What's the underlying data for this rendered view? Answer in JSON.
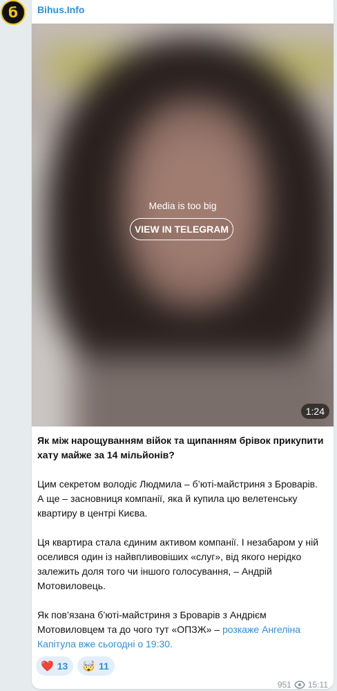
{
  "avatar": {
    "glyph": "б"
  },
  "post": {
    "channel_name": "Bihus.Info",
    "media": {
      "message": "Media is too big",
      "button_label": "VIEW IN TELEGRAM",
      "duration": "1:24"
    },
    "headline": "Як між нарощуванням війок та щипанням брівок прикупити хату майже за 14 мільйонів?",
    "paragraph1": "Цим секретом володіє Людмила – б’юті-майстриня з Броварів. А ще – засновниця компанії, яка й купила цю велетенську квартиру в центрі Києва.",
    "paragraph2": "Ця квартира стала єдиним активом компанії. І незабаром у ній оселився один із найвпливовіших «слуг», від якого нерідко залежить доля того чи іншого голосування, – Андрій Мотовиловець.",
    "paragraph3_prefix": "Як пов’язана б’юті-майстриня з Броварів з Андрієм Мотовиловцем та до чого тут «ОПЗЖ» – ",
    "paragraph3_link": "розкаже Ангеліна Капітула вже сьогодні о 19:30.",
    "reactions": [
      {
        "emoji": "❤️",
        "count": "13"
      },
      {
        "emoji": "🤯",
        "count": "11"
      }
    ],
    "views": "951",
    "time": "15:11"
  },
  "colors": {
    "accent": "#2f8fd8",
    "brand_yellow": "#f2c40f",
    "background": "#e6ebee"
  }
}
